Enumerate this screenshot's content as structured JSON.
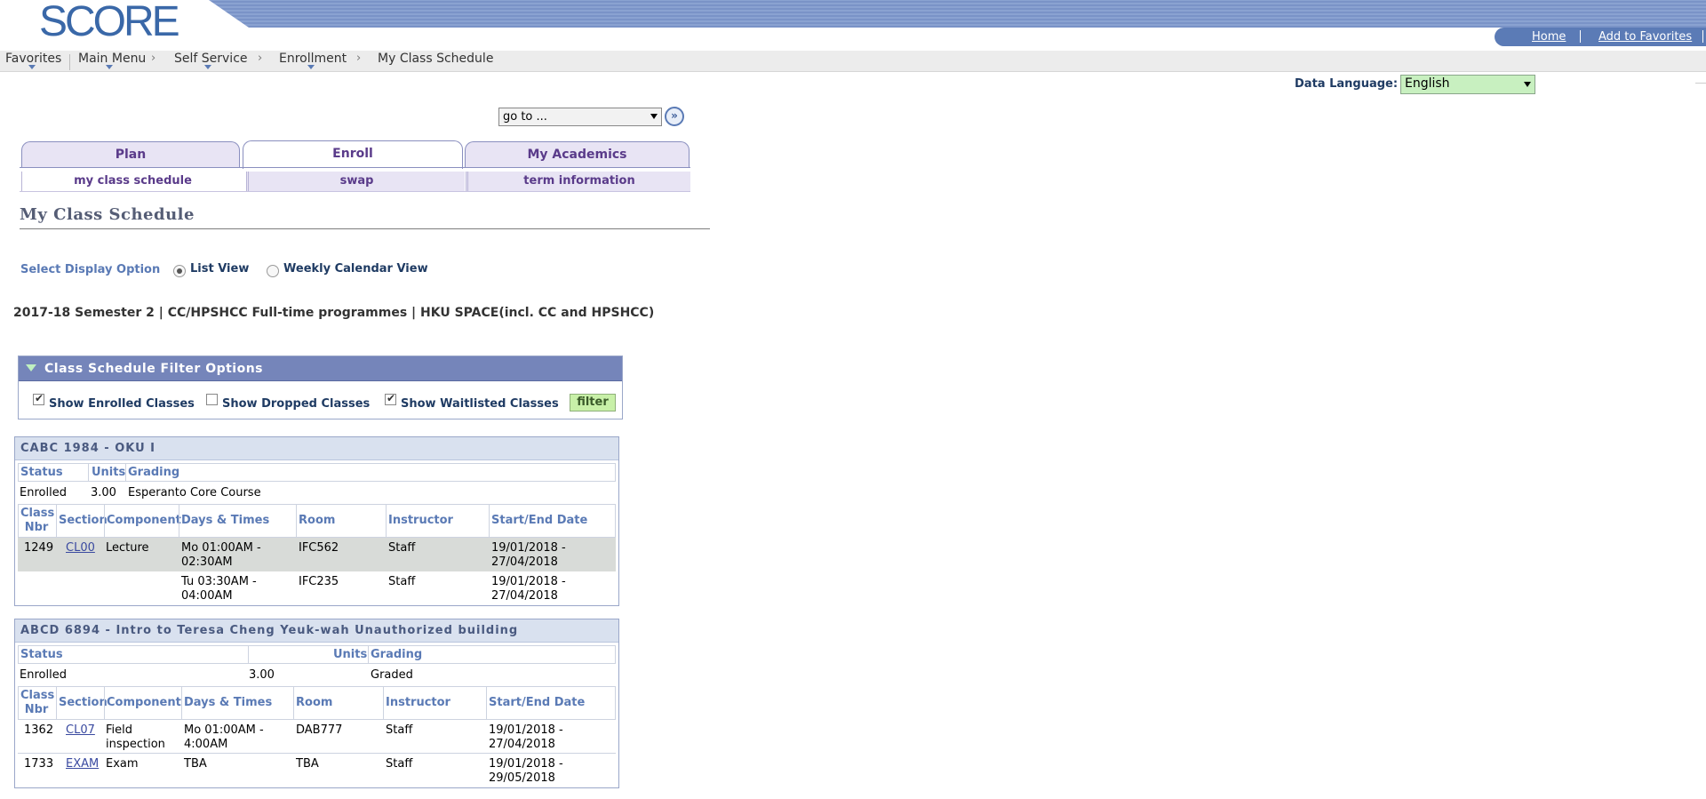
{
  "header": {
    "logo": "SCORE",
    "links": {
      "home": "Home",
      "favorites": "Add to Favorites"
    }
  },
  "breadcrumb": {
    "favorites": "Favorites",
    "main_menu": "Main Menu",
    "self_service": "Self Service",
    "enrollment": "Enrollment",
    "current": "My Class Schedule"
  },
  "data_language": {
    "label": "Data Language:",
    "value": "English"
  },
  "goto": {
    "value": "go to ..."
  },
  "tabs": {
    "plan": "Plan",
    "enroll": "Enroll",
    "academics": "My Academics"
  },
  "subtabs": {
    "schedule": "my class schedule",
    "swap": "swap",
    "term": "term information"
  },
  "page_title": "My Class Schedule",
  "display": {
    "label": "Select Display Option",
    "list": "List View",
    "weekly": "Weekly Calendar View"
  },
  "term": "2017-18 Semester 2 | CC/HPSHCC Full-time programmes | HKU SPACE(incl. CC and HPSHCC)",
  "filter": {
    "title": "Class Schedule Filter Options",
    "enrolled": "Show Enrolled Classes",
    "dropped": "Show Dropped Classes",
    "waitlisted": "Show Waitlisted Classes",
    "button": "filter"
  },
  "table_headers": {
    "status": "Status",
    "units": "Units",
    "grading": "Grading",
    "class_nbr_1": "Class",
    "class_nbr_2": "Nbr",
    "section": "Section",
    "component": "Component",
    "days_times": "Days & Times",
    "room": "Room",
    "instructor": "Instructor",
    "dates": "Start/End Date"
  },
  "classes": [
    {
      "title": "CABC 1984 - OKU I",
      "status": "Enrolled",
      "units": "3.00",
      "grading": "Esperanto Core Course",
      "rows": [
        {
          "nbr": "1249",
          "section": "CL00",
          "component": "Lecture",
          "days1": "Mo 01:00AM -",
          "days2": "02:30AM",
          "room": "IFC562",
          "instructor": "Staff",
          "date1": "19/01/2018 -",
          "date2": "27/04/2018"
        },
        {
          "nbr": "",
          "section": "",
          "component": "",
          "days1": "Tu 03:30AM -",
          "days2": "04:00AM",
          "room": "IFC235",
          "instructor": "Staff",
          "date1": "19/01/2018 -",
          "date2": "27/04/2018"
        }
      ]
    },
    {
      "title": "ABCD 6894 - Intro to Teresa Cheng Yeuk-wah Unauthorized building",
      "status": "Enrolled",
      "units": "3.00",
      "grading": "Graded",
      "rows": [
        {
          "nbr": "1362",
          "section": "CL07",
          "component1": "Field",
          "component2": "inspection",
          "days1": "Mo 01:00AM -",
          "days2": "4:00AM",
          "room": "DAB777",
          "instructor": "Staff",
          "date1": "19/01/2018 -",
          "date2": "27/04/2018"
        },
        {
          "nbr": "1733",
          "section": "EXAM",
          "component": "Exam",
          "days1": "TBA",
          "room": "TBA",
          "instructor": "Staff",
          "date1": "19/01/2018 -",
          "date2": "29/05/2018"
        }
      ]
    }
  ]
}
